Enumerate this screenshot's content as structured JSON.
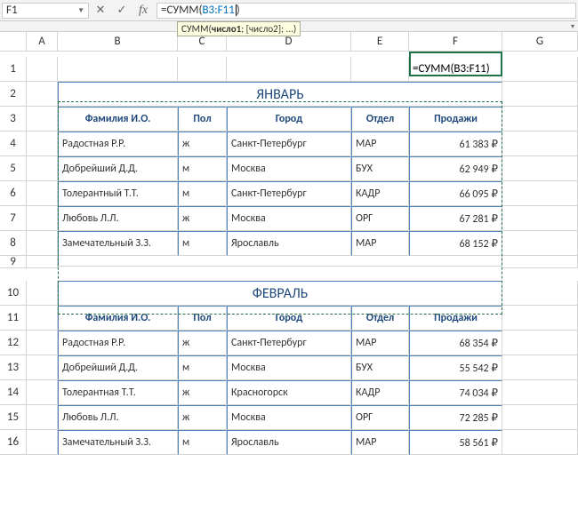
{
  "nameBox": "F1",
  "formula": {
    "prefix": "=СУММ(",
    "ref": "B3:F11",
    "suffix": ")"
  },
  "tooltip": {
    "fn": "СУММ",
    "arg1": "число1",
    "rest": "; [число2]; ...)"
  },
  "activeCellDisplay": "=СУММ(B3:F11)",
  "columns": [
    "A",
    "B",
    "C",
    "D",
    "E",
    "F",
    "G"
  ],
  "rows": [
    "1",
    "2",
    "3",
    "4",
    "5",
    "6",
    "7",
    "8",
    "9",
    "10",
    "11",
    "12",
    "13",
    "14",
    "15",
    "16"
  ],
  "months": {
    "jan": "ЯНВАРЬ",
    "feb": "ФЕВРАЛЬ"
  },
  "headers": {
    "name": "Фамилия И.О.",
    "sex": "Пол",
    "city": "Город",
    "dept": "Отдел",
    "sales": "Продажи"
  },
  "janRows": [
    {
      "name": "Радостная Р.Р.",
      "sex": "ж",
      "city": "Санкт-Петербург",
      "dept": "МАР",
      "sales": "61 383 ₽"
    },
    {
      "name": "Добрейший Д.Д.",
      "sex": "м",
      "city": "Москва",
      "dept": "БУХ",
      "sales": "62 949 ₽"
    },
    {
      "name": "Толерантный Т.Т.",
      "sex": "м",
      "city": "Санкт-Петербург",
      "dept": "КАДР",
      "sales": "66 095 ₽"
    },
    {
      "name": "Любовь Л.Л.",
      "sex": "ж",
      "city": "Москва",
      "dept": "ОРГ",
      "sales": "67 281 ₽"
    },
    {
      "name": "Замечательный З.З.",
      "sex": "м",
      "city": "Ярославль",
      "dept": "МАР",
      "sales": "68 152 ₽"
    }
  ],
  "febRows": [
    {
      "name": "Радостная Р.Р.",
      "sex": "ж",
      "city": "Санкт-Петербург",
      "dept": "МАР",
      "sales": "68 354 ₽"
    },
    {
      "name": "Добрейший Д.Д.",
      "sex": "м",
      "city": "Москва",
      "dept": "БУХ",
      "sales": "55 542 ₽"
    },
    {
      "name": "Толерантная Т.Т.",
      "sex": "ж",
      "city": "Красногорск",
      "dept": "КАДР",
      "sales": "74 034 ₽"
    },
    {
      "name": "Любовь Л.Л.",
      "sex": "ж",
      "city": "Москва",
      "dept": "ОРГ",
      "sales": "72 285 ₽"
    },
    {
      "name": "Замечательный З.З.",
      "sex": "м",
      "city": "Ярославль",
      "dept": "МАР",
      "sales": "58 561 ₽"
    }
  ]
}
